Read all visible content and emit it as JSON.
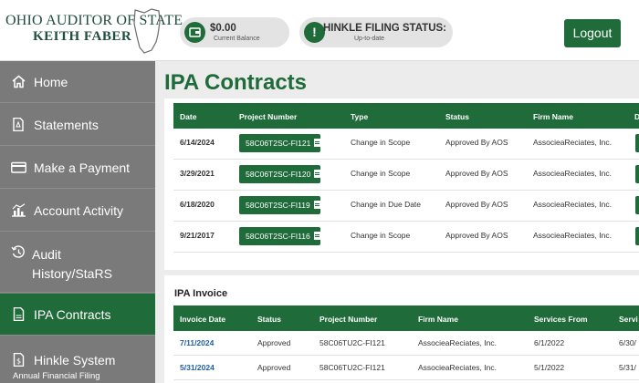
{
  "header": {
    "logo_line1": "OHIO AUDITOR OF STATE",
    "logo_line2": "KEITH FABER",
    "balance": {
      "amount": "$0.00",
      "label": "Current Balance"
    },
    "filing_status": {
      "title": "HINKLE FILING STATUS:",
      "sub": "Up-to-date"
    },
    "logout_label": "Logout"
  },
  "sidebar": {
    "items": [
      {
        "label": "Home",
        "icon": "home-icon"
      },
      {
        "label": "Statements",
        "icon": "pdf-icon"
      },
      {
        "label": "Make a Payment",
        "icon": "credit-card-icon"
      },
      {
        "label": "Account Activity",
        "icon": "bar-chart-icon"
      },
      {
        "label": "Audit History/StaRS",
        "icon": "history-icon"
      },
      {
        "label": "IPA Contracts",
        "icon": "document-icon",
        "active": true
      },
      {
        "label": "Hinkle System",
        "sub": "Annual Financial Filing",
        "icon": "document-dollar-icon"
      }
    ]
  },
  "main": {
    "title": "IPA Contracts",
    "contracts": {
      "columns": [
        "Date",
        "Project Number",
        "Type",
        "Status",
        "Firm Name",
        "D"
      ],
      "rows": [
        {
          "date": "6/14/2024",
          "project": "58C06T2SC-FI121",
          "type": "Change in Scope",
          "status": "Approved By AOS",
          "firm": "AssocieaReciates, Inc."
        },
        {
          "date": "3/29/2021",
          "project": "58C06T2SC-FI120",
          "type": "Change in Scope",
          "status": "Approved By AOS",
          "firm": "AssocieaReciates, Inc."
        },
        {
          "date": "6/18/2020",
          "project": "58C06T2SC-FI119",
          "type": "Change in Due Date",
          "status": "Approved By AOS",
          "firm": "AssocieaReciates, Inc."
        },
        {
          "date": "9/21/2017",
          "project": "58C06T2SC-FI116",
          "type": "Change in Scope",
          "status": "Approved By AOS",
          "firm": "AssocieaReciates, Inc."
        }
      ]
    },
    "invoice": {
      "title": "IPA Invoice",
      "columns": [
        "Invoice Date",
        "Status",
        "Project Number",
        "Firm Name",
        "Services From",
        "Servi"
      ],
      "rows": [
        {
          "date": "7/11/2024",
          "status": "Approved",
          "project": "58C06TU2C-FI121",
          "firm": "AssocieaReciates, Inc.",
          "from": "6/1/2022",
          "to": "6/30/"
        },
        {
          "date": "5/31/2024",
          "status": "Approved",
          "project": "58C06TU2C-FI121",
          "firm": "AssocieaReciates, Inc.",
          "from": "5/1/2022",
          "to": "5/31/"
        }
      ]
    }
  },
  "colors": {
    "brand_green": "#1f6b3a",
    "sidebar_gray": "#7a7a7a",
    "link_blue": "#1f5ea8"
  }
}
